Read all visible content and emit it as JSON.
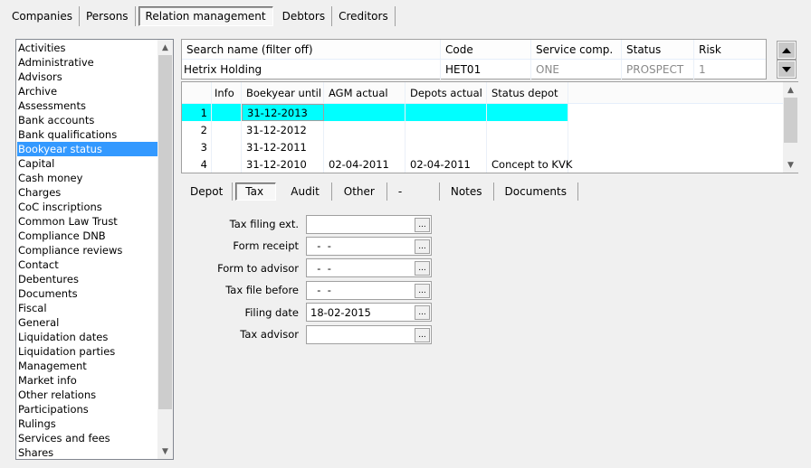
{
  "top_tabs": [
    {
      "label": "Companies",
      "active": false
    },
    {
      "label": "Persons",
      "active": false
    },
    {
      "label": "Relation management",
      "active": true
    },
    {
      "label": "Debtors",
      "active": false
    },
    {
      "label": "Creditors",
      "active": false
    }
  ],
  "sidebar": {
    "selected": "Bookyear status",
    "items": [
      "Activities",
      "Administrative",
      "Advisors",
      "Archive",
      "Assessments",
      "Bank accounts",
      "Bank qualifications",
      "Bookyear status",
      "Capital",
      "Cash money",
      "Charges",
      "CoC inscriptions",
      "Common Law Trust",
      "Compliance DNB",
      "Compliance reviews",
      "Contact",
      "Debentures",
      "Documents",
      "Fiscal",
      "General",
      "Liquidation dates",
      "Liquidation parties",
      "Management",
      "Market info",
      "Other relations",
      "Participations",
      "Rulings",
      "Services and fees",
      "Shares"
    ]
  },
  "header_grid": {
    "columns": [
      "Search name (filter off)",
      "Code",
      "Service comp.",
      "Status",
      "Risk"
    ],
    "row": {
      "search_name": "Hetrix Holding",
      "code": "HET01",
      "service_comp": "ONE",
      "status": "PROSPECT",
      "risk": "1"
    }
  },
  "years_grid": {
    "columns": [
      "",
      "Info",
      "Boekyear until",
      "AGM actual",
      "Depots actual",
      "Status depot"
    ],
    "rows": [
      {
        "num": "1",
        "info": "",
        "boekyear_until": "31-12-2013",
        "agm_actual": "",
        "depots_actual": "",
        "status_depot": "",
        "selected": true
      },
      {
        "num": "2",
        "info": "",
        "boekyear_until": "31-12-2012",
        "agm_actual": "",
        "depots_actual": "",
        "status_depot": ""
      },
      {
        "num": "3",
        "info": "",
        "boekyear_until": "31-12-2011",
        "agm_actual": "",
        "depots_actual": "",
        "status_depot": ""
      },
      {
        "num": "4",
        "info": "",
        "boekyear_until": "31-12-2010",
        "agm_actual": "02-04-2011",
        "depots_actual": "02-04-2011",
        "status_depot": "Concept to KVK"
      }
    ]
  },
  "sub_tabs": [
    {
      "label": "Depot",
      "active": false
    },
    {
      "label": "Tax",
      "active": true
    },
    {
      "label": "Audit",
      "active": false
    },
    {
      "label": "Other",
      "active": false
    },
    {
      "label": "-",
      "active": false
    },
    {
      "label": "Notes",
      "active": false
    },
    {
      "label": "Documents",
      "active": false
    }
  ],
  "tax_form": [
    {
      "label": "Tax filing ext.",
      "value": ""
    },
    {
      "label": "Form receipt",
      "value": "  -  -"
    },
    {
      "label": "Form to advisor",
      "value": "  -  -"
    },
    {
      "label": "Tax file before",
      "value": "  -  -"
    },
    {
      "label": "Filing date",
      "value": "18-02-2015"
    },
    {
      "label": "Tax advisor",
      "value": ""
    }
  ],
  "ellipsis_label": "...",
  "colors": {
    "selection": "#3399ff",
    "row_highlight": "#00ffff"
  }
}
